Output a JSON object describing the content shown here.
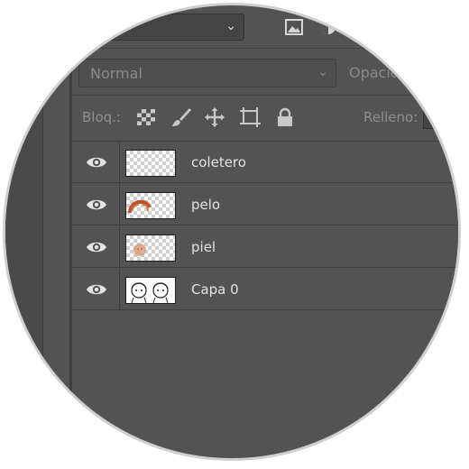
{
  "top": {
    "dropdown_value": "",
    "icons": [
      "image-filter-icon",
      "adjustment-filter-icon"
    ]
  },
  "blend_mode": {
    "value": "Normal"
  },
  "opacity_label": "Opacid",
  "lock_row": {
    "label": "Bloq.:",
    "icons": [
      "lock-transparent-pixels-icon",
      "lock-image-pixels-icon",
      "lock-position-icon",
      "lock-artboard-icon",
      "lock-all-icon"
    ],
    "fill_label": "Relleno:"
  },
  "layers": [
    {
      "name": "coletero",
      "visible": true,
      "thumbnail": "transparent"
    },
    {
      "name": "pelo",
      "visible": true,
      "thumbnail": "hair-drawing"
    },
    {
      "name": "piel",
      "visible": true,
      "thumbnail": "skin-drawing"
    },
    {
      "name": "Capa 0",
      "visible": true,
      "thumbnail": "sketch-drawing"
    }
  ],
  "colors": {
    "panel_bg": "#535353",
    "text": "#e4e4e4",
    "muted_text": "#8a8a8a",
    "icon": "#c8c8c8",
    "hair": "#c0502e",
    "skin": "#d9a07a"
  }
}
